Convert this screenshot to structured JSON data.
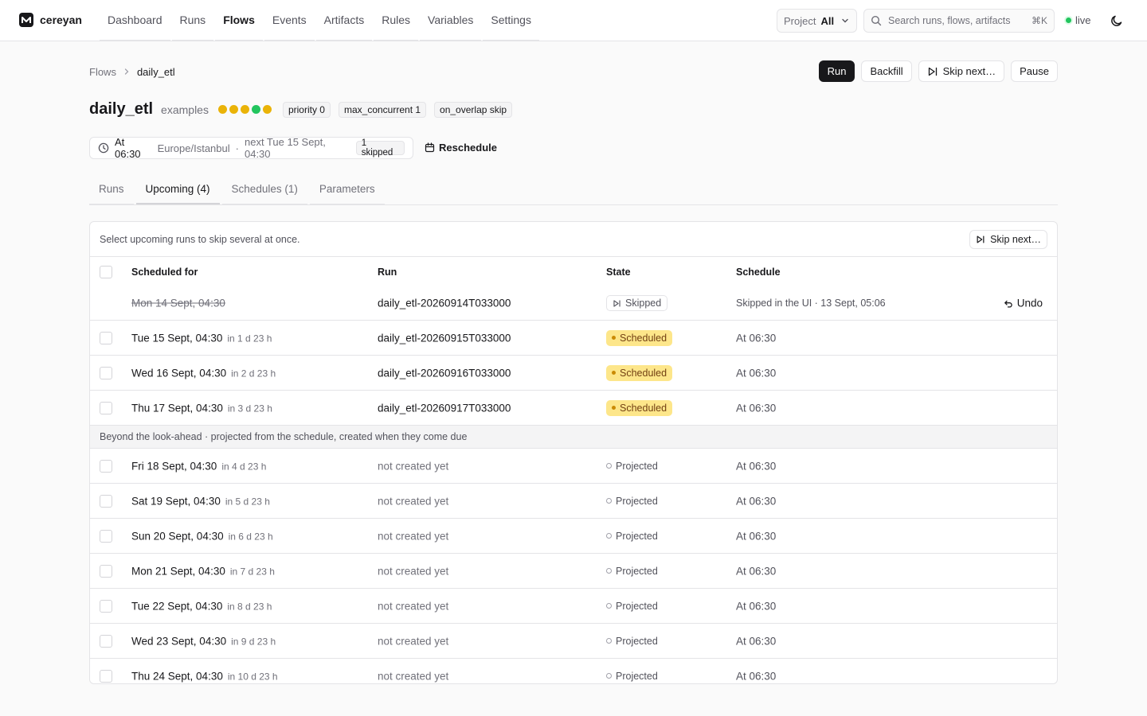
{
  "brand": {
    "name": "cereyan"
  },
  "nav": {
    "items": [
      {
        "label": "Dashboard"
      },
      {
        "label": "Runs"
      },
      {
        "label": "Flows"
      },
      {
        "label": "Events"
      },
      {
        "label": "Artifacts"
      },
      {
        "label": "Rules"
      },
      {
        "label": "Variables"
      },
      {
        "label": "Settings"
      }
    ],
    "active": "Flows"
  },
  "project": {
    "label": "Project",
    "value": "All"
  },
  "search": {
    "placeholder": "Search runs, flows, artifacts",
    "shortcut": "⌘K"
  },
  "live": {
    "label": "live",
    "color": "#22c55e"
  },
  "breadcrumb": {
    "parent": "Flows",
    "current": "daily_etl"
  },
  "actions": {
    "run": "Run",
    "backfill": "Backfill",
    "skip_next": "Skip next…",
    "pause": "Pause"
  },
  "flow": {
    "title": "daily_etl",
    "subtitle": "examples",
    "recent_states": [
      {
        "state": "scheduled",
        "color": "#eab308"
      },
      {
        "state": "scheduled",
        "color": "#eab308"
      },
      {
        "state": "scheduled",
        "color": "#eab308"
      },
      {
        "state": "completed",
        "color": "#22c55e"
      },
      {
        "state": "scheduled",
        "color": "#eab308"
      }
    ],
    "tags": [
      "priority 0",
      "max_concurrent 1",
      "on_overlap skip"
    ]
  },
  "schedule_summary": {
    "time": "At 06:30",
    "timezone": "Europe/Istanbul",
    "separator": "·",
    "next": "next Tue 15 Sept, 04:30",
    "skipped": "1 skipped",
    "reschedule": "Reschedule"
  },
  "tabs": [
    {
      "label": "Runs",
      "active": false
    },
    {
      "label": "Upcoming (4)",
      "active": true
    },
    {
      "label": "Schedules (1)",
      "active": false
    },
    {
      "label": "Parameters",
      "active": false
    }
  ],
  "upcoming": {
    "hint": "Select upcoming runs to skip several at once.",
    "skip_button": "Skip next…",
    "columns": [
      "Scheduled for",
      "Run",
      "State",
      "Schedule"
    ],
    "skipped_row": {
      "when": "Mon 14 Sept, 04:30",
      "run": "daily_etl-20260914T033000",
      "state": "Skipped",
      "schedule": "Skipped in the UI · 13 Sept, 05:06",
      "undo": "Undo"
    },
    "scheduled_rows": [
      {
        "when": "Tue 15 Sept, 04:30",
        "rel": "in 1 d 23 h",
        "run": "daily_etl-20260915T033000",
        "state": "Scheduled",
        "schedule": "At 06:30"
      },
      {
        "when": "Wed 16 Sept, 04:30",
        "rel": "in 2 d 23 h",
        "run": "daily_etl-20260916T033000",
        "state": "Scheduled",
        "schedule": "At 06:30"
      },
      {
        "when": "Thu 17 Sept, 04:30",
        "rel": "in 3 d 23 h",
        "run": "daily_etl-20260917T033000",
        "state": "Scheduled",
        "schedule": "At 06:30"
      }
    ],
    "lookahead_note": "Beyond the look-ahead · projected from the schedule, created when they come due",
    "projected_rows": [
      {
        "when": "Fri 18 Sept, 04:30",
        "rel": "in 4 d 23 h",
        "run": "not created yet",
        "state": "Projected",
        "schedule": "At 06:30"
      },
      {
        "when": "Sat 19 Sept, 04:30",
        "rel": "in 5 d 23 h",
        "run": "not created yet",
        "state": "Projected",
        "schedule": "At 06:30"
      },
      {
        "when": "Sun 20 Sept, 04:30",
        "rel": "in 6 d 23 h",
        "run": "not created yet",
        "state": "Projected",
        "schedule": "At 06:30"
      },
      {
        "when": "Mon 21 Sept, 04:30",
        "rel": "in 7 d 23 h",
        "run": "not created yet",
        "state": "Projected",
        "schedule": "At 06:30"
      },
      {
        "when": "Tue 22 Sept, 04:30",
        "rel": "in 8 d 23 h",
        "run": "not created yet",
        "state": "Projected",
        "schedule": "At 06:30"
      },
      {
        "when": "Wed 23 Sept, 04:30",
        "rel": "in 9 d 23 h",
        "run": "not created yet",
        "state": "Projected",
        "schedule": "At 06:30"
      },
      {
        "when": "Thu 24 Sept, 04:30",
        "rel": "in 10 d 23 h",
        "run": "not created yet",
        "state": "Projected",
        "schedule": "At 06:30"
      }
    ]
  }
}
